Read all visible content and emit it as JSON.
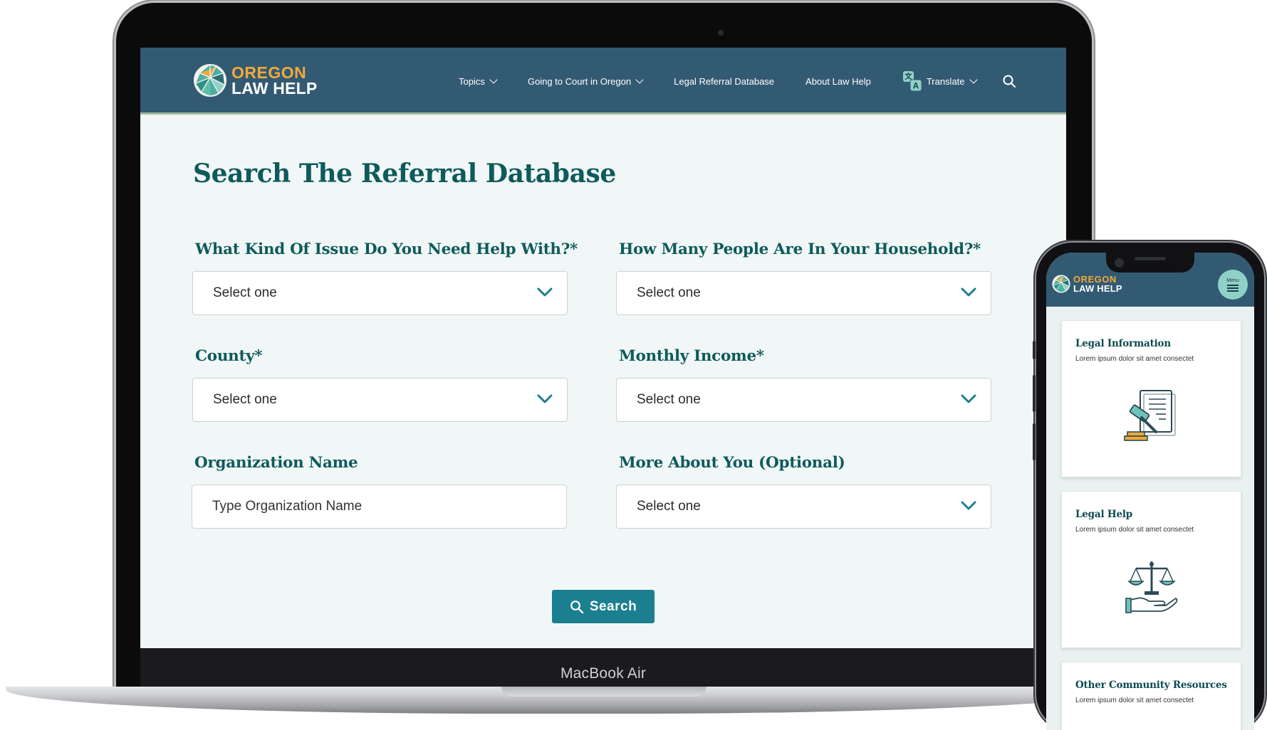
{
  "laptop": {
    "model_label": "MacBook Air"
  },
  "site": {
    "logo": {
      "line1": "OREGON",
      "line2": "LAW HELP"
    },
    "nav": {
      "items": [
        {
          "label": "Topics",
          "has_dropdown": true
        },
        {
          "label": "Going to Court in Oregon",
          "has_dropdown": true
        },
        {
          "label": "Legal Referral Database",
          "has_dropdown": false
        },
        {
          "label": "About Law Help",
          "has_dropdown": false
        },
        {
          "label": "Translate",
          "has_dropdown": true
        }
      ],
      "search_icon": "search-icon",
      "translate_icon": "translate-icon"
    },
    "colors": {
      "header": "#335a73",
      "accent": "#1b7f8f",
      "heading": "#0f5a5b",
      "logo_orange": "#f2a93b"
    }
  },
  "form": {
    "title": "Search The Referral Database",
    "issue": {
      "label": "What Kind Of Issue Do You Need Help With?*",
      "value": "Select one"
    },
    "household": {
      "label": "How Many People Are In Your Household?*",
      "value": "Select one"
    },
    "county": {
      "label": "County*",
      "value": "Select one"
    },
    "income": {
      "label": "Monthly Income*",
      "value": "Select one"
    },
    "organization": {
      "label": "Organization Name",
      "placeholder": "Type Organization Name"
    },
    "about": {
      "label": "More About You (Optional)",
      "value": "Select one"
    },
    "search_button": "Search"
  },
  "phone": {
    "menu_label": "Menu",
    "cards": [
      {
        "title": "Legal Information",
        "desc": "Lorem ipsum dolor sit amet consectet",
        "icon": "gavel-document-icon"
      },
      {
        "title": "Legal Help",
        "desc": "Lorem ipsum dolor sit amet consectet",
        "icon": "scales-hand-icon"
      },
      {
        "title": "Other Community Resources",
        "desc": "Lorem ipsum dolor sit amet consectet",
        "icon": ""
      }
    ]
  }
}
